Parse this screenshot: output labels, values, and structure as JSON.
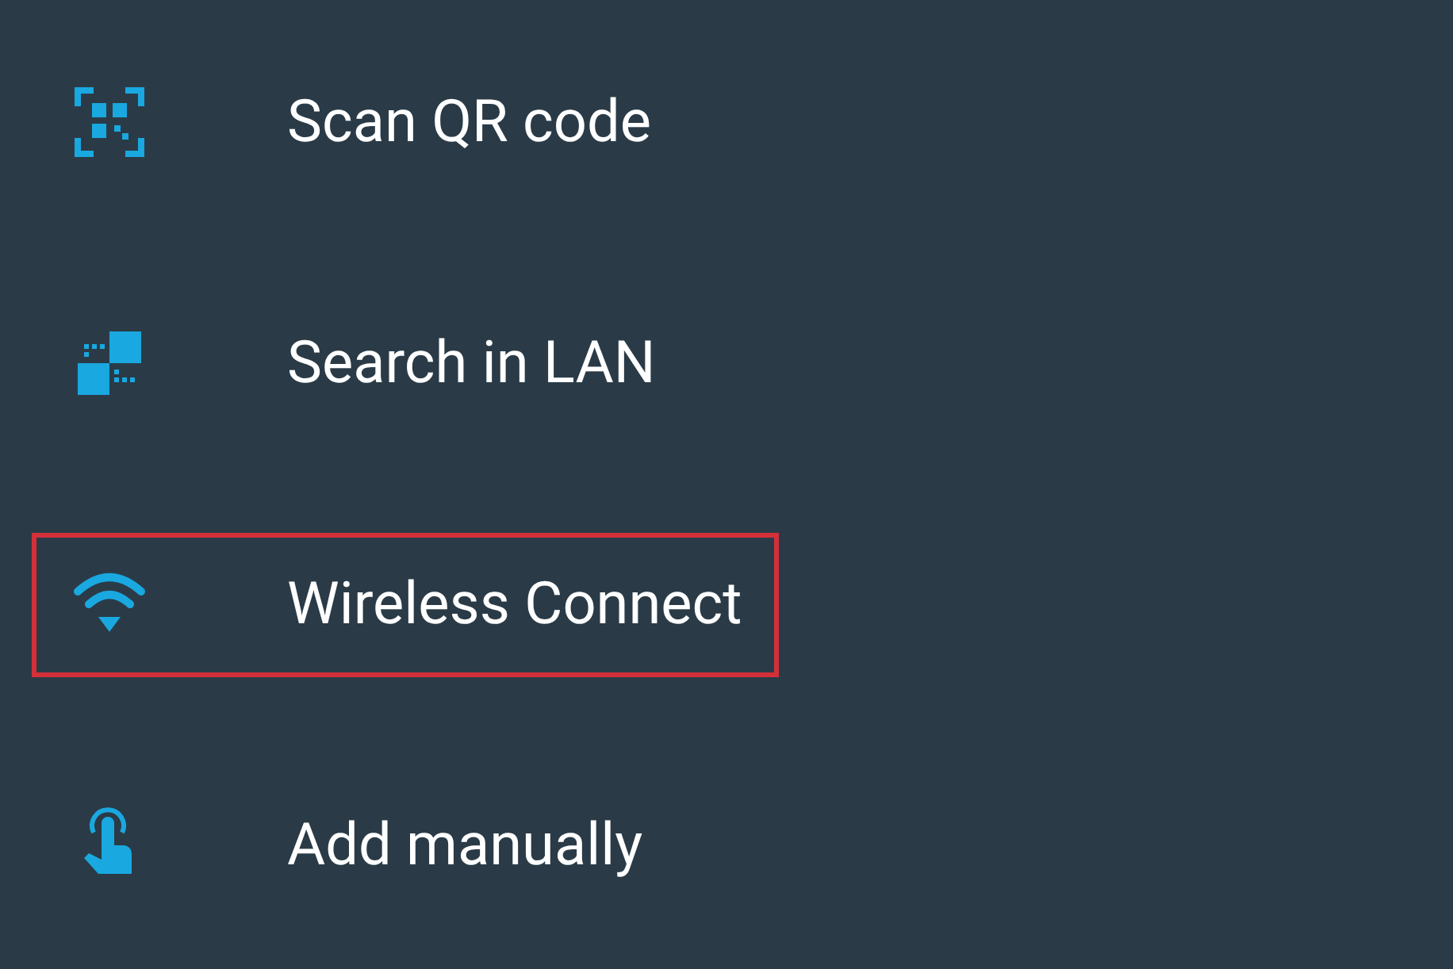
{
  "menu": [
    {
      "kind": "qr",
      "label": "Scan QR code",
      "highlighted": false
    },
    {
      "kind": "lan",
      "label": "Search in LAN",
      "highlighted": false
    },
    {
      "kind": "wifi",
      "label": "Wireless Connect",
      "highlighted": true
    },
    {
      "kind": "touch",
      "label": "Add manually",
      "highlighted": false
    }
  ]
}
